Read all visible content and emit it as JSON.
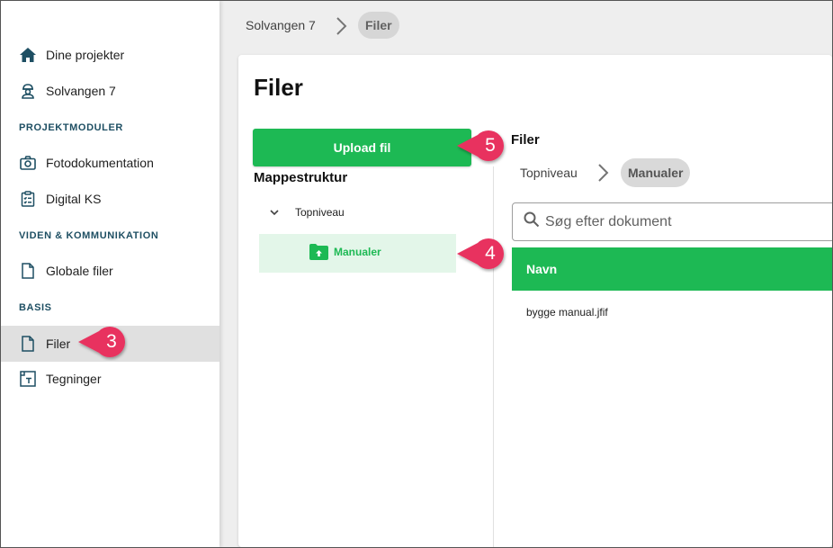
{
  "sidebar": {
    "items": [
      {
        "label": "Dine projekter",
        "icon": "home-icon"
      },
      {
        "label": "Solvangen 7",
        "icon": "worker-icon"
      },
      {
        "label": "Fotodokumentation",
        "icon": "camera-icon"
      },
      {
        "label": "Digital KS",
        "icon": "clipboard-icon"
      },
      {
        "label": "Globale filer",
        "icon": "file-icon"
      },
      {
        "label": "Filer",
        "icon": "file-icon"
      },
      {
        "label": "Tegninger",
        "icon": "drawing-icon"
      }
    ],
    "sections": [
      "PROJEKTMODULER",
      "VIDEN & KOMMUNIKATION",
      "BASIS"
    ],
    "active_item": "Filer"
  },
  "breadcrumb": {
    "items": [
      "Solvangen 7",
      "Filer"
    ]
  },
  "page": {
    "title": "Filer",
    "upload_label": "Upload fil",
    "folder_heading": "Mappestruktur",
    "tree": {
      "root": "Topniveau",
      "selected": "Manualer"
    }
  },
  "files": {
    "heading": "Filer",
    "breadcrumb": [
      "Topniveau",
      "Manualer"
    ],
    "search_placeholder": "Søg efter dokument",
    "column_name": "Navn",
    "rows": [
      "bygge manual.jfif"
    ]
  },
  "callouts": [
    "3",
    "4",
    "5"
  ],
  "colors": {
    "accent_green": "#1db954",
    "callout_pink": "#e8335f",
    "section_teal": "#1e4f63"
  }
}
